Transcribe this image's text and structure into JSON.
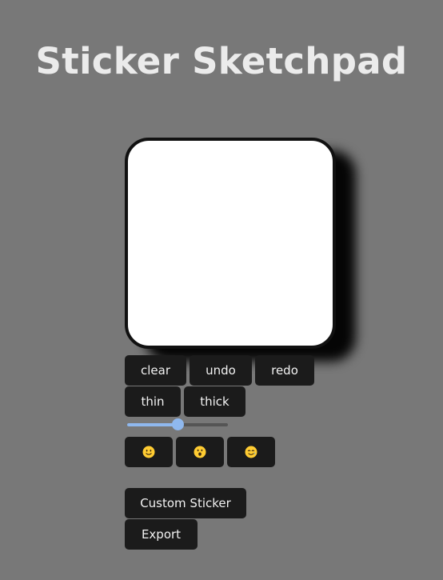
{
  "app": {
    "title": "Sticker Sketchpad"
  },
  "toolbar": {
    "clear_label": "clear",
    "undo_label": "undo",
    "redo_label": "redo",
    "thin_label": "thin",
    "thick_label": "thick"
  },
  "brush_size": {
    "value_fraction": 0.5
  },
  "stickers": [
    {
      "name": "slightly-smiling-face-icon"
    },
    {
      "name": "surprised-face-icon"
    },
    {
      "name": "smiling-face-with-tear-icon"
    }
  ],
  "actions": {
    "custom_sticker_label": "Custom Sticker",
    "export_label": "Export"
  },
  "colors": {
    "background": "#787878",
    "button": "#1b1b1b",
    "accent": "#8fb8ee",
    "emoji": "#ffcc32"
  }
}
